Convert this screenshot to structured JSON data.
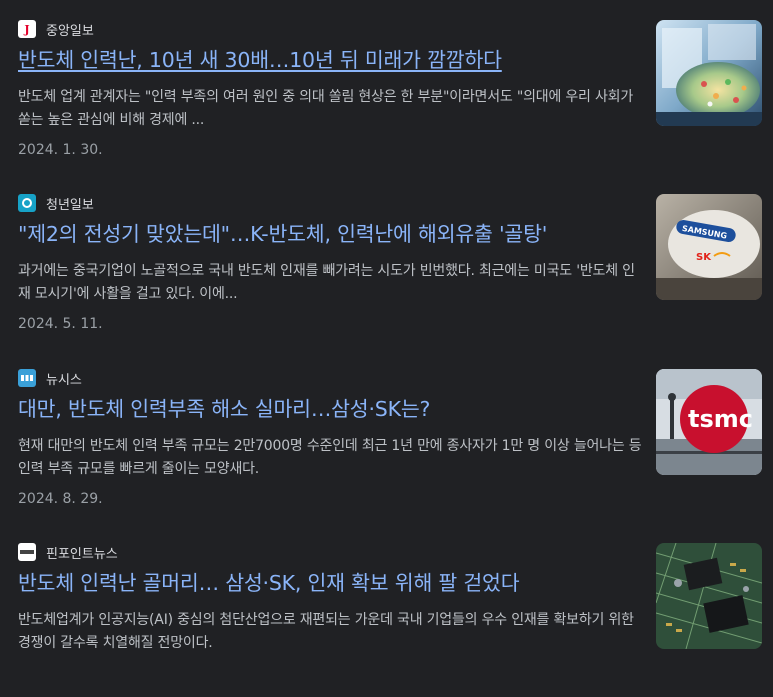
{
  "results": [
    {
      "source": "중앙일보",
      "favicon_letter": "J",
      "title": "반도체 인력난, 10년 새 30배…10년 뒤 미래가 깜깜하다",
      "snippet": "반도체 업계 관계자는 \"인력 부족의 여러 원인 중 의대 쏠림 현상은 한 부분\"이라면서도 \"의대에 우리 사회가 쏟는 높은 관심에 비해 경제에 ...",
      "date": "2024. 1. 30.",
      "thumb_icon": "semiconductor-wafer-photo"
    },
    {
      "source": "청년일보",
      "favicon_letter": "",
      "title": "\"제2의 전성기 맞았는데\"…K-반도체, 인력난에 해외유출 '골탕'",
      "snippet": "과거에는 중국기업이 노골적으로 국내 반도체 인재를 빼가려는 시도가 빈번했다. 최근에는 미국도 '반도체 인재 모시기'에 사활을 걸고 있다. 이에...",
      "date": "2024. 5. 11.",
      "thumb_icon": "samsung-sk-logos-photo"
    },
    {
      "source": "뉴시스",
      "favicon_letter": "",
      "title": "대만, 반도체 인력부족 해소 실마리…삼성·SK는?",
      "snippet": "현재 대만의 반도체 인력 부족 규모는 2만7000명 수준인데 최근 1년 만에 종사자가 1만 명 이상 늘어나는 등 인력 부족 규모를 빠르게 줄이는 모양새다.",
      "date": "2024. 8. 29.",
      "thumb_icon": "tsmc-sign-photo"
    },
    {
      "source": "핀포인트뉴스",
      "favicon_letter": "",
      "title": "반도체 인력난 골머리… 삼성·SK, 인재 확보 위해 팔 걷었다",
      "snippet": "반도체업계가 인공지능(AI) 중심의 첨단산업으로 재편되는 가운데 국내 기업들의 우수 인재를 확보하기 위한 경쟁이 갈수록 치열해질 전망이다.",
      "date": "",
      "thumb_icon": "circuit-board-photo"
    }
  ],
  "thumb_texts": {
    "samsung": "SAMSUNG",
    "sk": "SK",
    "tsmc": "tsmc"
  },
  "colors": {
    "background": "#202124",
    "link": "#8ab4f8",
    "snippet": "#bdc1c6",
    "date": "#9aa0a6"
  }
}
